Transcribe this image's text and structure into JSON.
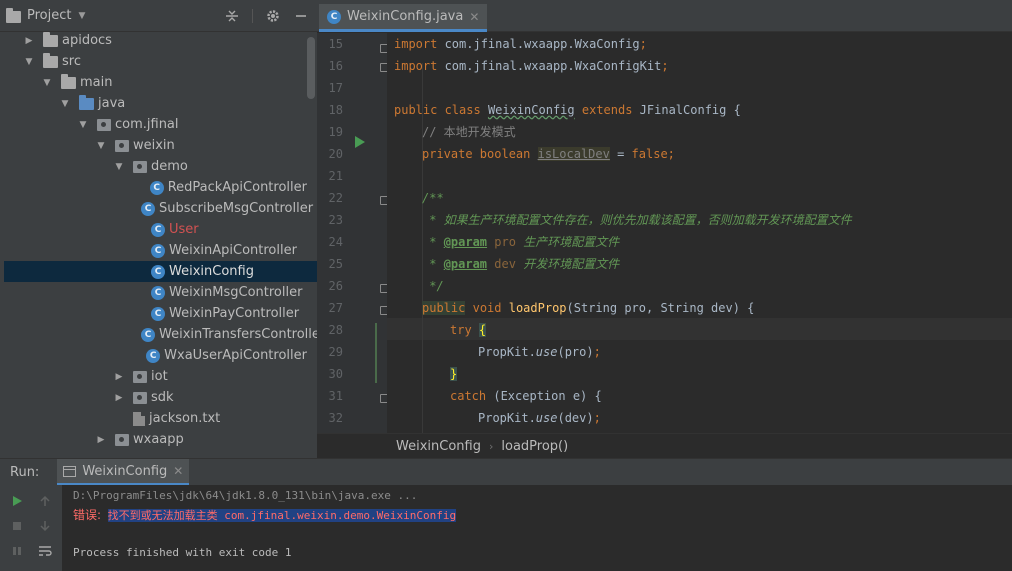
{
  "project": {
    "title": "Project",
    "tree": [
      {
        "label": "apidocs",
        "depth": 1,
        "kind": "folder",
        "arrow": "right"
      },
      {
        "label": "src",
        "depth": 1,
        "kind": "folder",
        "arrow": "down"
      },
      {
        "label": "main",
        "depth": 2,
        "kind": "folder",
        "arrow": "down"
      },
      {
        "label": "java",
        "depth": 3,
        "kind": "srcfolder",
        "arrow": "down"
      },
      {
        "label": "com.jfinal",
        "depth": 4,
        "kind": "package",
        "arrow": "down"
      },
      {
        "label": "weixin",
        "depth": 5,
        "kind": "package",
        "arrow": "down"
      },
      {
        "label": "demo",
        "depth": 6,
        "kind": "package",
        "arrow": "down"
      },
      {
        "label": "RedPackApiController",
        "depth": 7,
        "kind": "class"
      },
      {
        "label": "SubscribeMsgController",
        "depth": 7,
        "kind": "class"
      },
      {
        "label": "User",
        "depth": 7,
        "kind": "class",
        "state": "error"
      },
      {
        "label": "WeixinApiController",
        "depth": 7,
        "kind": "class"
      },
      {
        "label": "WeixinConfig",
        "depth": 7,
        "kind": "class",
        "state": "selected"
      },
      {
        "label": "WeixinMsgController",
        "depth": 7,
        "kind": "class"
      },
      {
        "label": "WeixinPayController",
        "depth": 7,
        "kind": "class"
      },
      {
        "label": "WeixinTransfersController",
        "depth": 7,
        "kind": "class"
      },
      {
        "label": "WxaUserApiController",
        "depth": 7,
        "kind": "class"
      },
      {
        "label": "iot",
        "depth": 6,
        "kind": "package",
        "arrow": "right"
      },
      {
        "label": "sdk",
        "depth": 6,
        "kind": "package",
        "arrow": "right"
      },
      {
        "label": "jackson.txt",
        "depth": 6,
        "kind": "file"
      },
      {
        "label": "wxaapp",
        "depth": 5,
        "kind": "package",
        "arrow": "right"
      }
    ]
  },
  "editor": {
    "tab_label": "WeixinConfig.java",
    "line_numbers": [
      "15",
      "16",
      "17",
      "18",
      "19",
      "20",
      "21",
      "22",
      "23",
      "24",
      "25",
      "26",
      "27",
      "28",
      "29",
      "30",
      "31",
      "32"
    ],
    "lines": {
      "l15": {
        "kw": "import",
        "rest": " com.jfinal.wxaapp.WxaConfig",
        "semi": ";"
      },
      "l16": {
        "kw": "import",
        "rest": " com.jfinal.wxaapp.WxaConfigKit",
        "semi": ";"
      },
      "l18": {
        "kw1": "public class",
        "name": "WeixinConfig",
        "kw2": "extends",
        "rest": " JFinalConfig {"
      },
      "l19": {
        "comment": "// 本地开发模式"
      },
      "l20": {
        "kw": "private boolean",
        "field": "isLocalDev",
        "eq": " = ",
        "val": "false",
        "semi": ";"
      },
      "l22": {
        "doc": "/**"
      },
      "l23": {
        "doc": " * 如果生产环境配置文件存在，则优先加载该配置，否则加载开发环境配置文件"
      },
      "l24": {
        "star": " * ",
        "tag": "@param",
        "param": "pro",
        "text": " 生产环境配置文件"
      },
      "l25": {
        "star": " * ",
        "tag": "@param",
        "param": "dev",
        "text": " 开发环境配置文件"
      },
      "l26": {
        "doc": " */"
      },
      "l27": {
        "kw": "public",
        "kw_void": "void",
        "fn": "loadProp",
        "rest": "(String pro, String dev) {"
      },
      "l28": {
        "kw": "try",
        "brace": "{"
      },
      "l29": {
        "obj": "PropKit.",
        "method": "use",
        "rest": "(pro)",
        "semi": ";"
      },
      "l30": {
        "brace": "}"
      },
      "l31": {
        "kw": "catch",
        "rest": " (Exception e) {"
      },
      "l32": {
        "obj": "PropKit.",
        "method": "use",
        "rest": "(dev)",
        "semi": ";"
      }
    },
    "breadcrumb": [
      "WeixinConfig",
      "loadProp()"
    ]
  },
  "run": {
    "label": "Run:",
    "tab_label": "WeixinConfig",
    "console": {
      "cmd": "D:\\ProgramFiles\\jdk\\64\\jdk1.8.0_131\\bin\\java.exe ...",
      "error_label": "错误:",
      "error_msg": "找不到或无法加载主类 com.jfinal.weixin.demo.WeixinConfig",
      "finished": "Process finished with exit code 1"
    }
  }
}
